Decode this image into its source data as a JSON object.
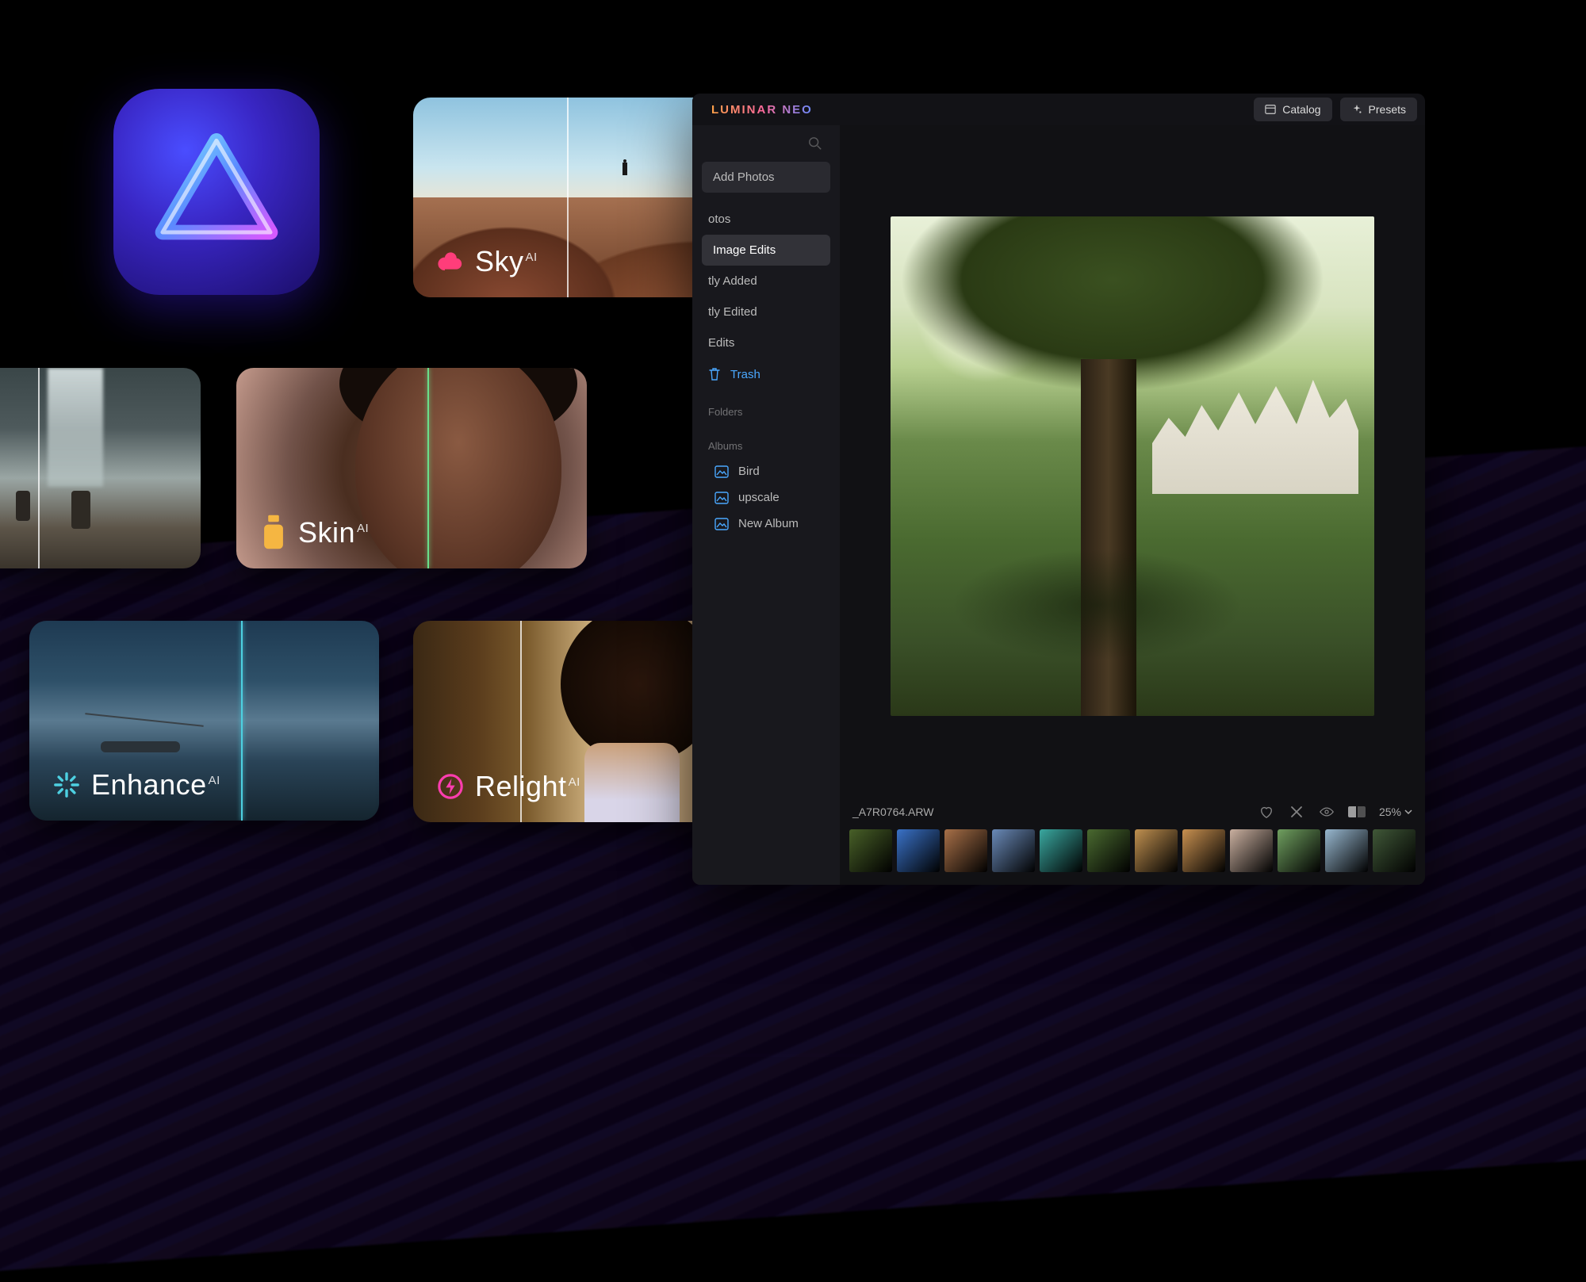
{
  "app": {
    "brand": "LUMINAR NEO"
  },
  "top_buttons": {
    "catalog": "Catalog",
    "presets": "Presets"
  },
  "sidebar": {
    "add_photos": "Add Photos",
    "items": [
      {
        "label": "otos"
      },
      {
        "label": "Image Edits"
      },
      {
        "label": "tly Added"
      },
      {
        "label": "tly Edited"
      },
      {
        "label": "Edits"
      }
    ],
    "trash": "Trash",
    "folders_header": "Folders",
    "albums_header": "Albums",
    "albums": [
      {
        "label": "Bird"
      },
      {
        "label": "upscale"
      },
      {
        "label": "New Album"
      }
    ]
  },
  "viewer": {
    "filename": "_A7R0764.ARW",
    "zoom": "25%"
  },
  "cards": {
    "sky": {
      "label": "Sky",
      "sup": "AI",
      "icon_color": "#ff3d7a"
    },
    "skin": {
      "label": "Skin",
      "sup": "AI",
      "icon_color": "#f5b642"
    },
    "enhance": {
      "label": "Enhance",
      "sup": "AI",
      "icon_color": "#4dd0e1"
    },
    "relight": {
      "label": "Relight",
      "sup": "AI",
      "icon_color": "#ff3db0"
    }
  },
  "filmstrip_colors": [
    "#486028",
    "#3a72c8",
    "#a87048",
    "#6a8ab8",
    "#3aa8a0",
    "#4a6a30",
    "#c09050",
    "#c89050",
    "#cab0a0",
    "#70a060",
    "#98b8d0",
    "#405838"
  ]
}
